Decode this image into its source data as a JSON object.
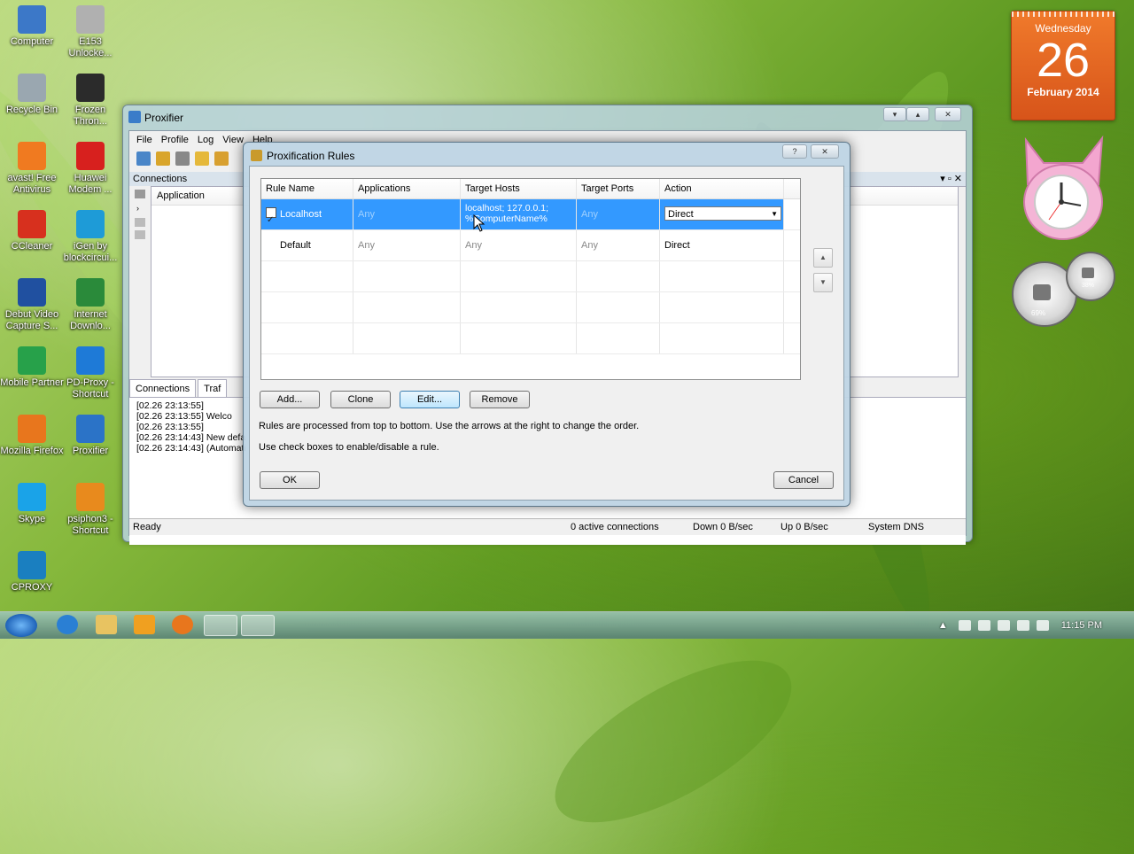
{
  "desktop": {
    "icons": [
      {
        "label": "Computer",
        "color": "#3c78c8"
      },
      {
        "label": "E153 Unlocke...",
        "color": "#b0b0b0"
      },
      {
        "label": "Recycle Bin",
        "color": "#9aa7b0"
      },
      {
        "label": "Frozen Thron...",
        "color": "#2b2b2b"
      },
      {
        "label": "avast! Free Antivirus",
        "color": "#f07a20"
      },
      {
        "label": "Huawei Modem ...",
        "color": "#d7201e"
      },
      {
        "label": "CCleaner",
        "color": "#d7301e"
      },
      {
        "label": "iGen by blockcircui...",
        "color": "#1e9bd7"
      },
      {
        "label": "Debut Video Capture S...",
        "color": "#2050a0"
      },
      {
        "label": "Internet Downlo...",
        "color": "#2a8a3a"
      },
      {
        "label": "Mobile Partner",
        "color": "#27a14a"
      },
      {
        "label": "PD-Proxy - Shortcut",
        "color": "#1e7ad7"
      },
      {
        "label": "Mozilla Firefox",
        "color": "#e8761d"
      },
      {
        "label": "Proxifier",
        "color": "#2b73c7"
      },
      {
        "label": "Skype",
        "color": "#1aa3e8"
      },
      {
        "label": "psiphon3 - Shortcut",
        "color": "#e88a1d"
      },
      {
        "label": "CPROXY",
        "color": "#1a7fc0"
      }
    ]
  },
  "main_window": {
    "title": "Proxifier",
    "menu": [
      "File",
      "Profile",
      "Log",
      "View",
      "Help"
    ],
    "connections_header": "Connections",
    "column_application": "Application",
    "tabs": [
      "Connections",
      "Traf"
    ],
    "log_lines": [
      "[02.26 23:13:55]",
      "[02.26 23:13:55]   Welco",
      "[02.26 23:13:55]",
      "[02.26 23:14:43] New defa",
      "[02.26 23:14:43] (Automati"
    ],
    "status": {
      "ready": "Ready",
      "active": "0 active connections",
      "down": "Down 0 B/sec",
      "up": "Up 0 B/sec",
      "dns": "System DNS"
    }
  },
  "rules_dialog": {
    "title": "Proxification Rules",
    "help_label": "?",
    "close_label": "✕",
    "columns": [
      "Rule Name",
      "Applications",
      "Target Hosts",
      "Target Ports",
      "Action"
    ],
    "rules": [
      {
        "name": "Localhost",
        "applications": "Any",
        "target_hosts": "localhost; 127.0.0.1; %ComputerName%",
        "target_ports": "Any",
        "action": "Direct",
        "enabled": true
      },
      {
        "name": "Default",
        "applications": "Any",
        "target_hosts": "Any",
        "target_ports": "Any",
        "action": "Direct"
      }
    ],
    "buttons": {
      "add": "Add...",
      "clone": "Clone",
      "edit": "Edit...",
      "remove": "Remove",
      "ok": "OK",
      "cancel": "Cancel"
    },
    "note1": "Rules are processed from top to bottom. Use the arrows at the right to change the order.",
    "note2": "Use check boxes to enable/disable a rule."
  },
  "calendar": {
    "weekday": "Wednesday",
    "day": "26",
    "month_year": "February 2014"
  },
  "gauges": {
    "cpu": "69%",
    "mem": "38%"
  },
  "taskbar": {
    "time": "11:15 PM"
  }
}
